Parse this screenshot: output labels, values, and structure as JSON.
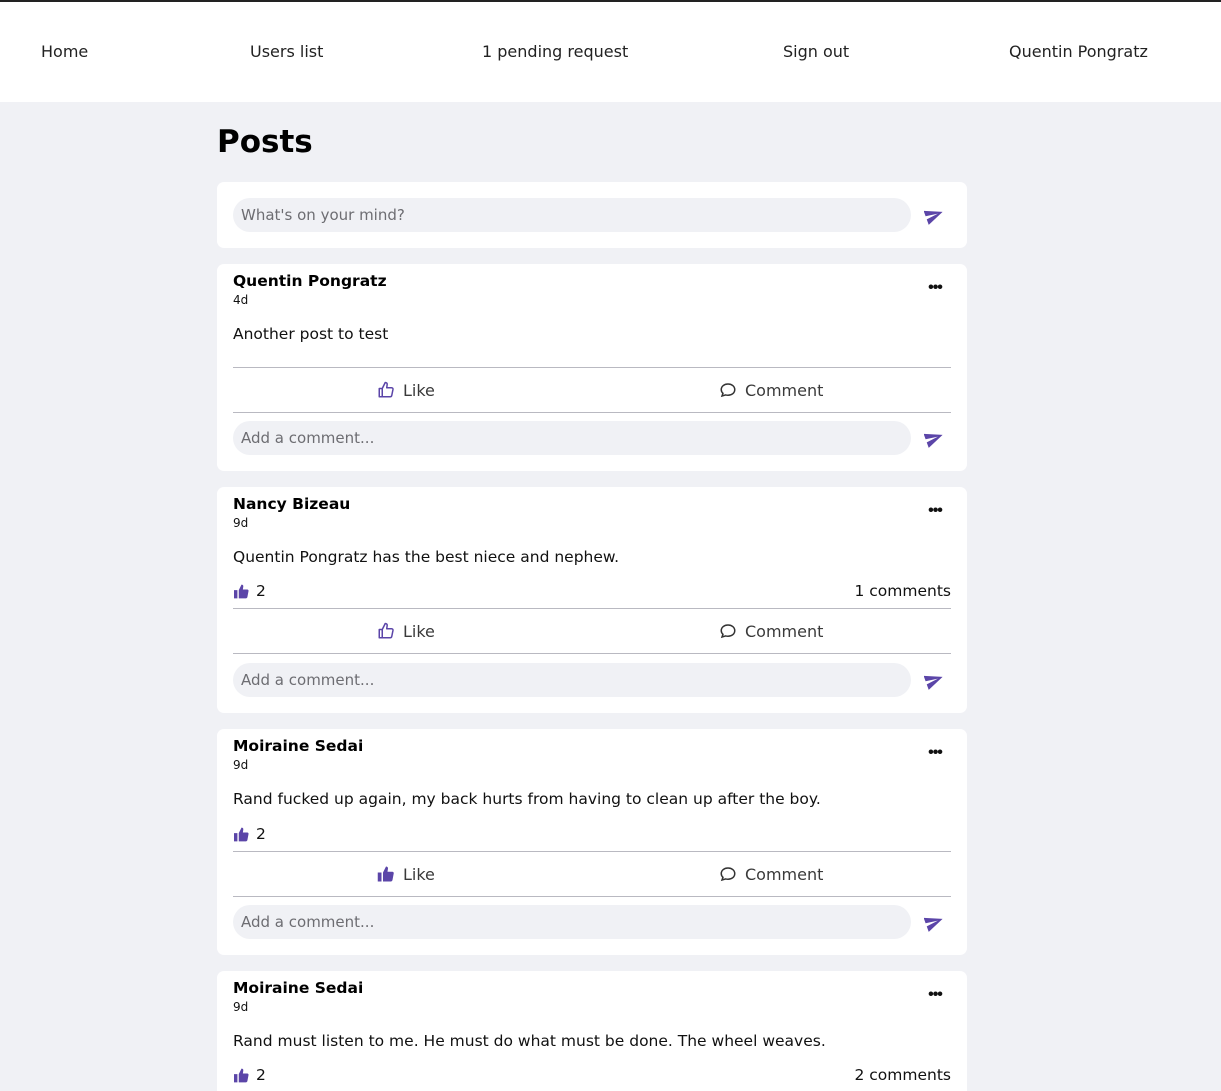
{
  "nav": {
    "home": "Home",
    "users_list": "Users list",
    "pending_requests": "1 pending request",
    "sign_out": "Sign out",
    "current_user": "Quentin Pongratz"
  },
  "page_title": "Posts",
  "composer": {
    "placeholder": "What's on your mind?"
  },
  "accent_color": "#5b45a8",
  "labels": {
    "like": "Like",
    "comment": "Comment",
    "comment_placeholder": "Add a comment..."
  },
  "posts": [
    {
      "author": "Quentin Pongratz",
      "time": "4d",
      "content": "Another post to test"
    },
    {
      "author": "Nancy Bizeau",
      "time": "9d",
      "content": "Quentin Pongratz has the best niece and nephew.",
      "likes": "2",
      "comments": "1 comments"
    },
    {
      "author": "Moiraine Sedai",
      "time": "9d",
      "content": "Rand fucked up again, my back hurts from having to clean up after the boy.",
      "likes": "2",
      "liked_by_me": true
    },
    {
      "author": "Moiraine Sedai",
      "time": "9d",
      "content": "Rand must listen to me. He must do what must be done. The wheel weaves.",
      "likes": "2",
      "comments": "2 comments"
    }
  ]
}
